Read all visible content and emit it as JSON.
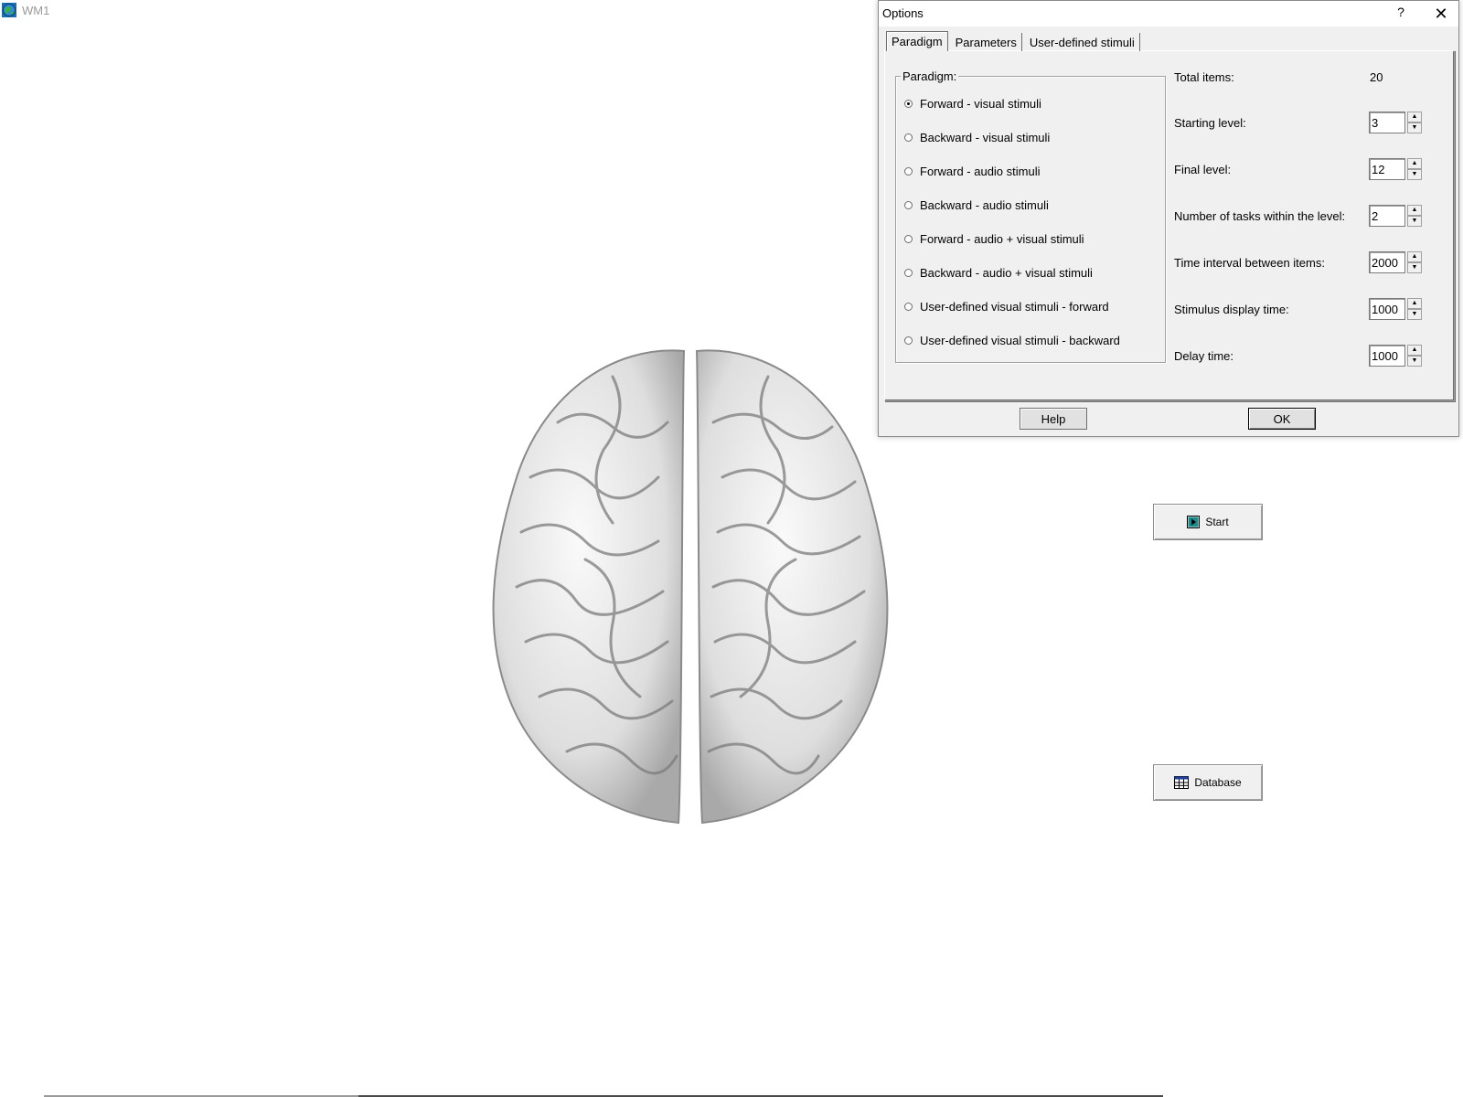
{
  "app": {
    "title": "WM1",
    "icon": "globe-icon"
  },
  "main": {
    "start_button": {
      "label": "Start",
      "icon": "play-icon"
    },
    "database_button": {
      "label": "Database",
      "icon": "table-icon"
    }
  },
  "dialog": {
    "title": "Options",
    "help_glyph": "?",
    "close_glyph": "✕",
    "tabs": [
      {
        "label": "Paradigm",
        "active": true
      },
      {
        "label": "Parameters",
        "active": false
      },
      {
        "label": "User-defined stimuli",
        "active": false
      }
    ],
    "paradigm": {
      "group_label": "Paradigm:",
      "options": [
        {
          "label": "Forward - visual stimuli",
          "checked": true
        },
        {
          "label": "Backward - visual stimuli",
          "checked": false
        },
        {
          "label": "Forward - audio stimuli",
          "checked": false
        },
        {
          "label": "Backward - audio stimuli",
          "checked": false
        },
        {
          "label": "Forward - audio + visual stimuli",
          "checked": false
        },
        {
          "label": "Backward - audio + visual stimuli",
          "checked": false
        },
        {
          "label": "User-defined visual stimuli - forward",
          "checked": false
        },
        {
          "label": "User-defined visual stimuli - backward",
          "checked": false
        }
      ]
    },
    "params": {
      "total_items": {
        "label": "Total items:",
        "value": "20"
      },
      "starting_level": {
        "label": "Starting level:",
        "value": "3"
      },
      "final_level": {
        "label": "Final level:",
        "value": "12"
      },
      "tasks_within_level": {
        "label": "Number of tasks within the level:",
        "value": "2"
      },
      "time_interval": {
        "label": "Time interval between items:",
        "value": "2000"
      },
      "display_time": {
        "label": "Stimulus display time:",
        "value": "1000"
      },
      "delay_time": {
        "label": "Delay time:",
        "value": "1000"
      }
    },
    "buttons": {
      "help": "Help",
      "ok": "OK"
    }
  },
  "spin_glyphs": {
    "up": "▲",
    "down": "▼"
  }
}
